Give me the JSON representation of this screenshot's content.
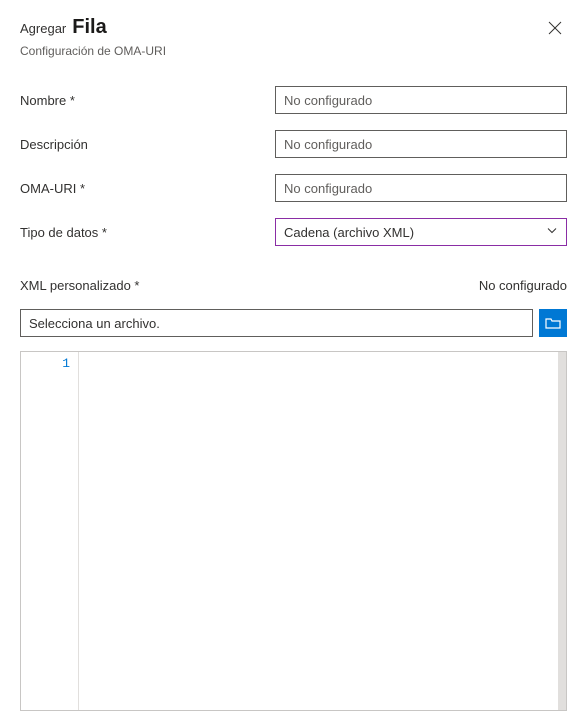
{
  "header": {
    "titlePre": "Agregar",
    "titleMain": "Fila",
    "subtitle": "Configuración de OMA-URI"
  },
  "form": {
    "nombre": {
      "label": "Nombre *",
      "placeholder": "No configurado",
      "value": ""
    },
    "descripcion": {
      "label": "Descripción",
      "placeholder": "No configurado",
      "value": ""
    },
    "omauri": {
      "label": "OMA-URI *",
      "placeholder": "No configurado",
      "value": ""
    },
    "tipoDatos": {
      "label": "Tipo de datos *",
      "selected": "Cadena (archivo XML)"
    }
  },
  "xml": {
    "label": "XML personalizado *",
    "status": "No configurado",
    "filePlaceholder": "Selecciona un archivo.",
    "fileValue": "",
    "lineNumber": "1"
  }
}
